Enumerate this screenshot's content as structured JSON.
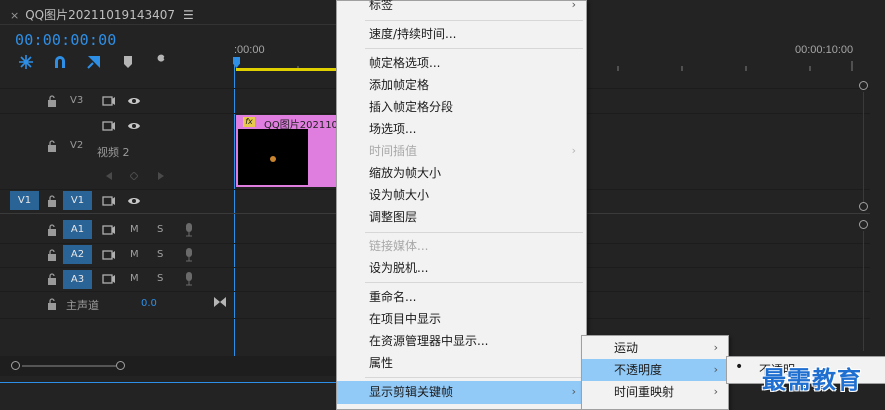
{
  "panel": {
    "close_glyph": "×",
    "title": "QQ图片20211019143407",
    "menu_glyph": "☰",
    "timecode": "00:00:00:00"
  },
  "ruler": {
    "start": ":00:00",
    "end": "00:00:10:00"
  },
  "tools": [
    "snap-icon",
    "linked-selection-icon",
    "add-marker-icon",
    "marker-icon",
    "wrench-icon"
  ],
  "tracks": {
    "v3": "V3",
    "v2": "V2",
    "v2_name": "视频 2",
    "v1_source": "V1",
    "v1": "V1",
    "a1": "A1",
    "a2": "A2",
    "a3": "A3",
    "m": "M",
    "s": "S",
    "master_label": "主声道",
    "master_value": "0.0"
  },
  "clip": {
    "fx": "fx",
    "name": "QQ图片2021101"
  },
  "context_menu": {
    "items": [
      {
        "label": "标签",
        "disabled": false,
        "submenu": true
      },
      {
        "label": "速度/持续时间...",
        "disabled": false,
        "submenu": false
      },
      {
        "label": "帧定格选项...",
        "disabled": false,
        "submenu": false
      },
      {
        "label": "添加帧定格",
        "disabled": false,
        "submenu": false
      },
      {
        "label": "插入帧定格分段",
        "disabled": false,
        "submenu": false
      },
      {
        "label": "场选项...",
        "disabled": false,
        "submenu": false
      },
      {
        "label": "时间插值",
        "disabled": true,
        "submenu": true
      },
      {
        "label": "缩放为帧大小",
        "disabled": false,
        "submenu": false
      },
      {
        "label": "设为帧大小",
        "disabled": false,
        "submenu": false
      },
      {
        "label": "调整图层",
        "disabled": false,
        "submenu": false
      },
      {
        "label": "链接媒体...",
        "disabled": true,
        "submenu": false
      },
      {
        "label": "设为脱机...",
        "disabled": false,
        "submenu": false
      },
      {
        "label": "重命名...",
        "disabled": false,
        "submenu": false
      },
      {
        "label": "在项目中显示",
        "disabled": false,
        "submenu": false
      },
      {
        "label": "在资源管理器中显示...",
        "disabled": false,
        "submenu": false
      },
      {
        "label": "属性",
        "disabled": false,
        "submenu": false
      },
      {
        "label": "显示剪辑关键帧",
        "disabled": false,
        "submenu": true
      }
    ]
  },
  "submenu": {
    "items": [
      {
        "label": "运动"
      },
      {
        "label": "不透明度"
      },
      {
        "label": "时间重映射"
      }
    ]
  },
  "submenu2": {
    "bullet": "•",
    "label": "不透明"
  },
  "watermark": "最需教育",
  "colors": {
    "accent": "#2e8fe6",
    "track_selected": "#2a6396",
    "clip": "#e07ee0",
    "menu_highlight": "#91c9f7"
  }
}
